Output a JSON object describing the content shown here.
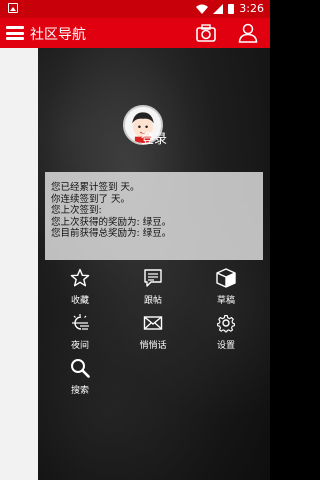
{
  "status_bar": {
    "time": "3:26"
  },
  "app_bar": {
    "title": "社区导航"
  },
  "drawer": {
    "login_label": "登录",
    "info_lines": [
      "您已经累计签到 天。",
      "你连续签到了 天。",
      "您上次签到:",
      "您上次获得的奖励为: 绿豆。",
      "您目前获得总奖励为: 绿豆。"
    ],
    "menu": [
      {
        "label": "收藏",
        "icon": "star-icon"
      },
      {
        "label": "跟帖",
        "icon": "reply-icon"
      },
      {
        "label": "草稿",
        "icon": "box-icon"
      },
      {
        "label": "夜间",
        "icon": "night-mode-icon"
      },
      {
        "label": "悄悄话",
        "icon": "mail-icon"
      },
      {
        "label": "设置",
        "icon": "gear-icon"
      },
      {
        "label": "搜索",
        "icon": "search-icon"
      }
    ]
  },
  "colors": {
    "primary": "#e0000f",
    "status_bar": "#c8000a"
  }
}
